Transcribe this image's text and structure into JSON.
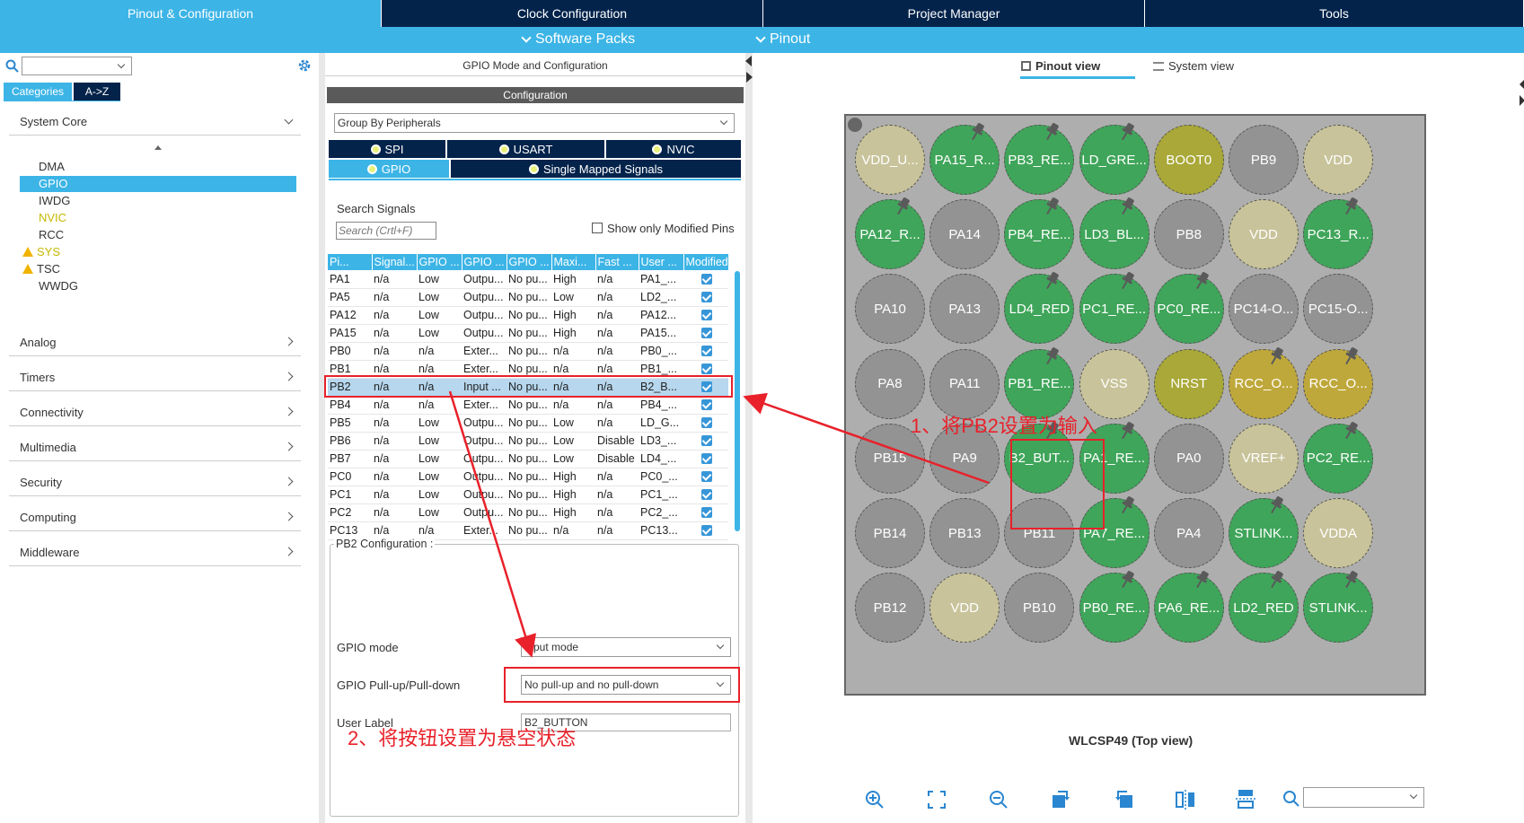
{
  "top_tabs": [
    "Pinout & Configuration",
    "Clock Configuration",
    "Project Manager",
    "Tools"
  ],
  "sub_menu": {
    "software_packs": "Software Packs",
    "pinout": "Pinout"
  },
  "left": {
    "categories_tab": "Categories",
    "az_tab": "A->Z",
    "system_core": "System Core",
    "system_core_items": [
      {
        "label": "DMA",
        "state": "normal"
      },
      {
        "label": "GPIO",
        "state": "selected"
      },
      {
        "label": "IWDG",
        "state": "normal"
      },
      {
        "label": "NVIC",
        "state": "yellow"
      },
      {
        "label": "RCC",
        "state": "normal"
      },
      {
        "label": "SYS",
        "state": "warn-yellow"
      },
      {
        "label": "TSC",
        "state": "warn"
      },
      {
        "label": "WWDG",
        "state": "normal"
      }
    ],
    "categories": [
      "Analog",
      "Timers",
      "Connectivity",
      "Multimedia",
      "Security",
      "Computing",
      "Middleware"
    ]
  },
  "middle": {
    "title": "GPIO Mode and Configuration",
    "config_header": "Configuration",
    "group_by": "Group By Peripherals",
    "peripheral_tabs": [
      "SPI",
      "USART",
      "NVIC",
      "GPIO",
      "Single Mapped Signals"
    ],
    "search_label": "Search Signals",
    "search_placeholder": "Search (Crtl+F)",
    "show_modified": "Show only Modified Pins",
    "columns": [
      "Pi...",
      "Signal...",
      "GPIO ...",
      "GPIO ...",
      "GPIO ...",
      "Maxi...",
      "Fast ...",
      "User ...",
      "Modified"
    ],
    "rows": [
      [
        "PA1",
        "n/a",
        "Low",
        "Outpu...",
        "No pu...",
        "High",
        "n/a",
        "PA1_..."
      ],
      [
        "PA5",
        "n/a",
        "Low",
        "Outpu...",
        "No pu...",
        "Low",
        "n/a",
        "LD2_..."
      ],
      [
        "PA12",
        "n/a",
        "Low",
        "Outpu...",
        "No pu...",
        "High",
        "n/a",
        "PA12..."
      ],
      [
        "PA15",
        "n/a",
        "Low",
        "Outpu...",
        "No pu...",
        "High",
        "n/a",
        "PA15..."
      ],
      [
        "PB0",
        "n/a",
        "n/a",
        "Exter...",
        "No pu...",
        "n/a",
        "n/a",
        "PB0_..."
      ],
      [
        "PB1",
        "n/a",
        "n/a",
        "Exter...",
        "No pu...",
        "n/a",
        "n/a",
        "PB1_..."
      ],
      [
        "PB2",
        "n/a",
        "n/a",
        "Input ...",
        "No pu...",
        "n/a",
        "n/a",
        "B2_B..."
      ],
      [
        "PB4",
        "n/a",
        "n/a",
        "Exter...",
        "No pu...",
        "n/a",
        "n/a",
        "PB4_..."
      ],
      [
        "PB5",
        "n/a",
        "Low",
        "Outpu...",
        "No pu...",
        "Low",
        "n/a",
        "LD_G..."
      ],
      [
        "PB6",
        "n/a",
        "Low",
        "Outpu...",
        "No pu...",
        "Low",
        "Disable",
        "LD3_..."
      ],
      [
        "PB7",
        "n/a",
        "Low",
        "Outpu...",
        "No pu...",
        "Low",
        "Disable",
        "LD4_..."
      ],
      [
        "PC0",
        "n/a",
        "Low",
        "Outpu...",
        "No pu...",
        "High",
        "n/a",
        "PC0_..."
      ],
      [
        "PC1",
        "n/a",
        "Low",
        "Outpu...",
        "No pu...",
        "High",
        "n/a",
        "PC1_..."
      ],
      [
        "PC2",
        "n/a",
        "Low",
        "Outpu...",
        "No pu...",
        "High",
        "n/a",
        "PC2_..."
      ],
      [
        "PC13",
        "n/a",
        "n/a",
        "Exter...",
        "No pu...",
        "n/a",
        "n/a",
        "PC13..."
      ]
    ],
    "selected_row": 6,
    "pb2_config": "PB2 Configuration :",
    "gpio_mode_label": "GPIO mode",
    "gpio_mode_value": "Input mode",
    "pull_label": "GPIO Pull-up/Pull-down",
    "pull_value": "No pull-up and no pull-down",
    "user_label": "User Label",
    "user_label_value": "B2_BUTTON"
  },
  "right": {
    "pinout_view": "Pinout view",
    "system_view": "System view",
    "package": "WLCSP49 (Top view)",
    "pins": [
      [
        [
          "VDD_U...",
          "beige",
          0
        ],
        [
          "PA15_R...",
          "green",
          1
        ],
        [
          "PB3_RE...",
          "green",
          1
        ],
        [
          "LD_GRE...",
          "green",
          1
        ],
        [
          "BOOT0",
          "olive",
          0
        ],
        [
          "PB9",
          "grey",
          0
        ],
        [
          "VDD",
          "beige",
          0
        ]
      ],
      [
        [
          "PA12_R...",
          "green",
          1
        ],
        [
          "PA14",
          "grey",
          0
        ],
        [
          "PB4_RE...",
          "green",
          1
        ],
        [
          "LD3_BL...",
          "green",
          1
        ],
        [
          "PB8",
          "grey",
          0
        ],
        [
          "VDD",
          "beige",
          0
        ],
        [
          "PC13_R...",
          "green",
          1
        ]
      ],
      [
        [
          "PA10",
          "grey",
          0
        ],
        [
          "PA13",
          "grey",
          0
        ],
        [
          "LD4_RED",
          "green",
          1
        ],
        [
          "PC1_RE...",
          "green",
          1
        ],
        [
          "PC0_RE...",
          "green",
          1
        ],
        [
          "PC14-O...",
          "grey",
          0
        ],
        [
          "PC15-O...",
          "grey",
          0
        ]
      ],
      [
        [
          "PA8",
          "grey",
          0
        ],
        [
          "PA11",
          "grey",
          0
        ],
        [
          "PB1_RE...",
          "green",
          1
        ],
        [
          "VSS",
          "beige",
          0
        ],
        [
          "NRST",
          "olive",
          0
        ],
        [
          "RCC_O...",
          "yellow",
          1
        ],
        [
          "RCC_O...",
          "yellow",
          1
        ]
      ],
      [
        [
          "PB15",
          "grey",
          0
        ],
        [
          "PA9",
          "grey",
          0
        ],
        [
          "B2_BUT...",
          "green",
          1
        ],
        [
          "PA1_RE...",
          "green",
          1
        ],
        [
          "PA0",
          "grey",
          0
        ],
        [
          "VREF+",
          "beige",
          0
        ],
        [
          "PC2_RE...",
          "green",
          1
        ]
      ],
      [
        [
          "PB14",
          "grey",
          0
        ],
        [
          "PB13",
          "grey",
          0
        ],
        [
          "PB11",
          "grey",
          0
        ],
        [
          "PA7_RE...",
          "green",
          1
        ],
        [
          "PA4",
          "grey",
          0
        ],
        [
          "STLINK...",
          "green",
          1
        ],
        [
          "VDDA",
          "beige",
          0
        ]
      ],
      [
        [
          "PB12",
          "grey",
          0
        ],
        [
          "VDD",
          "beige",
          0
        ],
        [
          "PB10",
          "grey",
          0
        ],
        [
          "PB0_RE...",
          "green",
          1
        ],
        [
          "PA6_RE...",
          "green",
          1
        ],
        [
          "LD2_RED",
          "green",
          1
        ],
        [
          "STLINK...",
          "green",
          1
        ]
      ]
    ]
  },
  "annotations": {
    "step1": "1、将PB2设置为输入",
    "step2": "2、将按钮设置为悬空状态"
  },
  "colors": {
    "accent": "#3cb4e6",
    "dark_nav": "#03234b",
    "annotation_red": "#e8212a"
  }
}
